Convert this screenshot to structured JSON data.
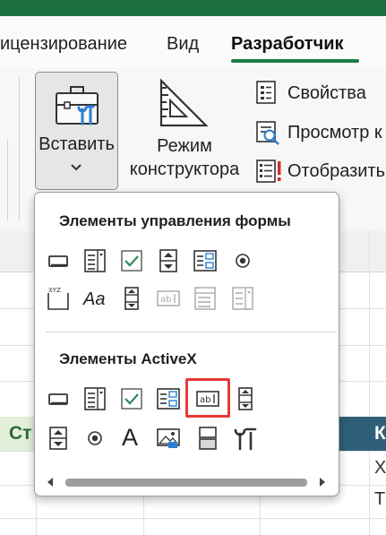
{
  "ribbon_tabs": [
    {
      "label": "ицензирование"
    },
    {
      "label": "Вид"
    },
    {
      "label": "Разработчик",
      "active": true
    }
  ],
  "controls_group": {
    "insert_button": {
      "label": "Вставить",
      "icon": "toolbox-icon"
    },
    "design_mode": {
      "label_line1": "Режим",
      "label_line2": "конструктора",
      "icon": "ruler-triangle-icon"
    },
    "commands": [
      {
        "label": "Свойства",
        "icon": "properties-icon"
      },
      {
        "label": "Просмотр к",
        "icon": "view-code-icon"
      },
      {
        "label": "Отобразить",
        "icon": "run-dialog-icon"
      }
    ]
  },
  "insert_dropdown": {
    "form_controls_title": "Элементы управления формы",
    "form_controls": [
      {
        "icon": "button-icon"
      },
      {
        "icon": "combo-box-icon"
      },
      {
        "icon": "check-box-icon"
      },
      {
        "icon": "spin-button-icon"
      },
      {
        "icon": "list-box-icon"
      },
      {
        "icon": "option-button-icon"
      },
      {
        "icon": "group-box-icon"
      },
      {
        "icon": "label-icon",
        "text": "Aa"
      },
      {
        "icon": "scroll-bar-icon"
      },
      {
        "icon": "text-field-icon",
        "disabled": true
      },
      {
        "icon": "combo-list-edit-icon",
        "disabled": true
      },
      {
        "icon": "combo-drop-down-edit-icon",
        "disabled": true
      }
    ],
    "activex_title": "Элементы ActiveX",
    "activex_controls": [
      {
        "icon": "command-button-icon"
      },
      {
        "icon": "combo-box-icon"
      },
      {
        "icon": "check-box-icon"
      },
      {
        "icon": "list-box-icon"
      },
      {
        "icon": "text-box-icon",
        "highlighted": true
      },
      {
        "icon": "scroll-bar-icon"
      },
      {
        "icon": "spin-button-icon"
      },
      {
        "icon": "option-button-icon"
      },
      {
        "icon": "label-icon",
        "text": "A"
      },
      {
        "icon": "image-icon"
      },
      {
        "icon": "toggle-button-icon"
      },
      {
        "icon": "more-controls-icon"
      }
    ]
  },
  "sheet": {
    "green_cell_text": "Ст",
    "header_cell_text": "К",
    "cell_a": "Х",
    "cell_b": "Т"
  },
  "colors": {
    "accent": "#1b7f45",
    "highlight": "#e53935",
    "activex_blue": "#2a7fd4",
    "check_green": "#2e8b57"
  }
}
